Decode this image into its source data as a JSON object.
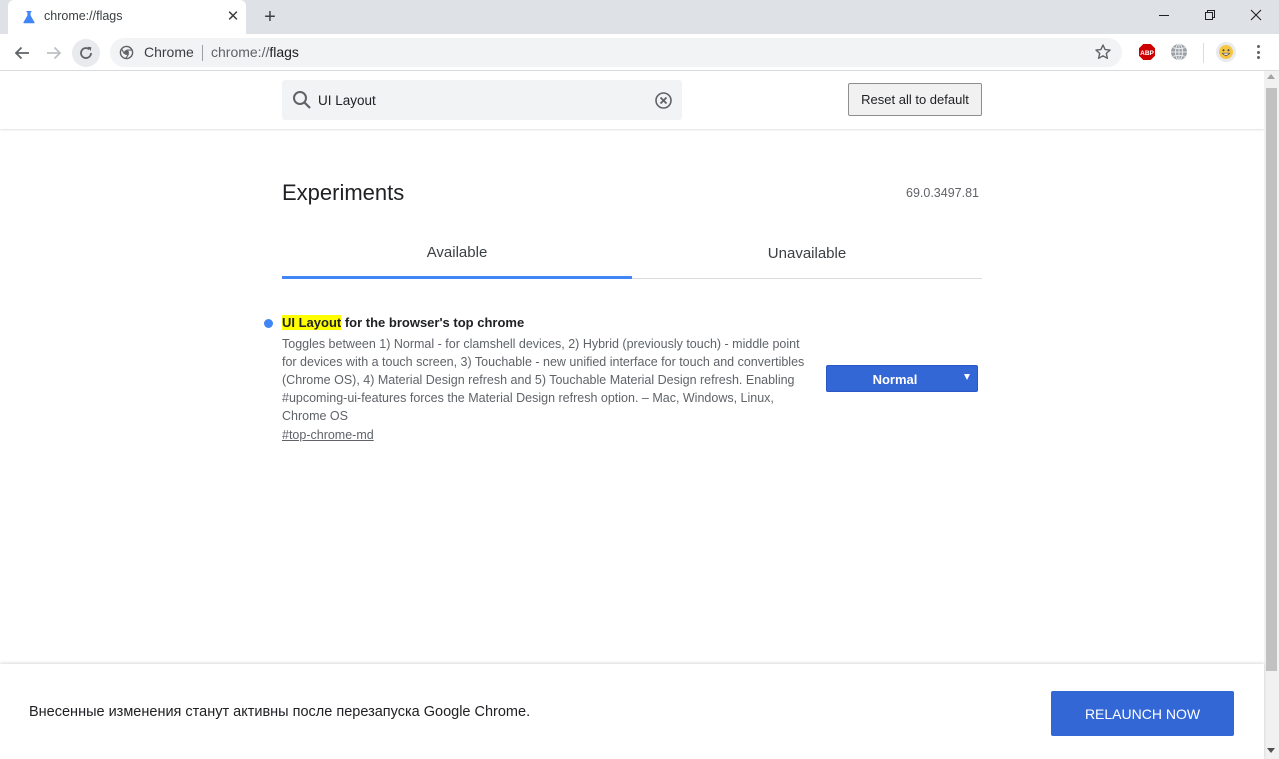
{
  "browser": {
    "tab": {
      "title": "chrome://flags"
    },
    "omnibox": {
      "chip": "Chrome",
      "url_scheme": "chrome://",
      "url_path": "flags"
    }
  },
  "flags_page": {
    "search": {
      "value": "UI Layout"
    },
    "reset_label": "Reset all to default",
    "title": "Experiments",
    "version": "69.0.3497.81",
    "tabs": [
      {
        "label": "Available"
      },
      {
        "label": "Unavailable"
      }
    ],
    "experiment": {
      "title_highlight": "UI Layout",
      "title_rest": " for the browser's top chrome",
      "description": "Toggles between 1) Normal - for clamshell devices, 2) Hybrid (previously touch) - middle point for devices with a touch screen, 3) Touchable - new unified interface for touch and convertibles (Chrome OS), 4) Material Design refresh and 5) Touchable Material Design refresh. Enabling #upcoming-ui-features forces the Material Design refresh option. – Mac, Windows, Linux, Chrome OS",
      "link": "#top-chrome-md",
      "selected_option": "Normal"
    }
  },
  "footer": {
    "message": "Внесенные изменения станут активны после перезапуска Google Chrome.",
    "relaunch_label": "RELAUNCH NOW"
  },
  "colors": {
    "accent": "#3367d6",
    "highlight": "#ffff00",
    "tab_underline": "#4285f4"
  }
}
